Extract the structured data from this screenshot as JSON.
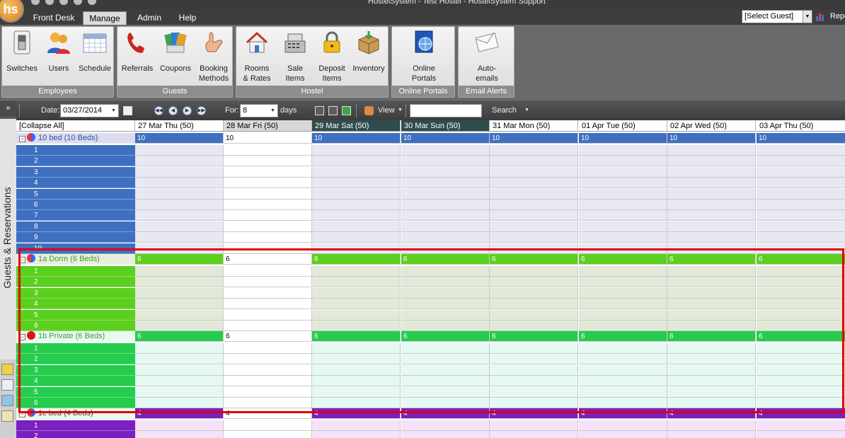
{
  "app": {
    "title": "HostelSystem - Test Hostel - HostelSystem Support",
    "logo_text": "hs"
  },
  "tabs": [
    {
      "label": "Front Desk"
    },
    {
      "label": "Manage"
    },
    {
      "label": "Admin"
    },
    {
      "label": "Help"
    }
  ],
  "guest_select": {
    "value": "[Select Guest]"
  },
  "report_label": "Repo",
  "ribbon": {
    "groups": [
      {
        "caption": "Employees",
        "buttons": [
          {
            "label": "Switches",
            "icon": "switch-icon"
          },
          {
            "label": "Users",
            "icon": "users-icon"
          },
          {
            "label": "Schedule",
            "icon": "calendar-icon"
          }
        ]
      },
      {
        "caption": "Guests",
        "buttons": [
          {
            "label": "Referrals",
            "icon": "phone-icon"
          },
          {
            "label": "Coupons",
            "icon": "coupons-icon"
          },
          {
            "label": "Booking\nMethods",
            "icon": "hand-icon"
          }
        ]
      },
      {
        "caption": "Hostel",
        "buttons": [
          {
            "label": "Rooms\n& Rates",
            "icon": "house-icon"
          },
          {
            "label": "Sale\nItems",
            "icon": "register-icon"
          },
          {
            "label": "Deposit\nItems",
            "icon": "lock-icon"
          },
          {
            "label": "Inventory",
            "icon": "box-icon"
          }
        ]
      },
      {
        "caption": "Online Portals",
        "buttons": [
          {
            "label": "Online\nPortals",
            "icon": "globe-icon"
          }
        ]
      },
      {
        "caption": "Email Alerts",
        "buttons": [
          {
            "label": "Auto-\nemails",
            "icon": "envelope-icon"
          }
        ]
      }
    ]
  },
  "side_panel": {
    "toggle": "»",
    "vertical_label": "Guests & Reservations"
  },
  "toolbar": {
    "date_label": "Date:",
    "date_value": "03/27/2014",
    "for_label": "For:",
    "for_value": "8",
    "days_label": "days",
    "view_label": "View",
    "search_value": "",
    "search_label": "Search"
  },
  "grid": {
    "collapse_label": "[Collapse All]",
    "columns": [
      "27 Mar Thu (50)",
      "28 Mar Fri (50)",
      "29 Mar Sat (50)",
      "30 Mar Sun (50)",
      "31 Mar Mon (50)",
      "01 Apr Tue (50)",
      "02 Apr Wed (50)",
      "03 Apr Thu (50)"
    ],
    "rooms": [
      {
        "name": "10 bed (10 Beds)",
        "count": "10",
        "beds": [
          "1",
          "2",
          "3",
          "4",
          "5",
          "6",
          "7",
          "8",
          "9",
          "10"
        ],
        "label_color": "#3f6fc0",
        "cell_color": "#e8e8f2",
        "header_color": "#3f6fc0"
      },
      {
        "name": "1a Dorm (6 Beds)",
        "count": "6",
        "beds": [
          "1",
          "2",
          "3",
          "4",
          "5",
          "6"
        ],
        "label_color": "#5bd01e",
        "cell_color": "#e3e9d8",
        "header_color": "#5bd01e"
      },
      {
        "name": "1b Private (6 Beds)",
        "count": "6",
        "beds": [
          "1",
          "2",
          "3",
          "4",
          "5",
          "6"
        ],
        "label_color": "#25cc4d",
        "cell_color": "#e6f8f2",
        "header_color": "#25cc4d"
      },
      {
        "name": "1c bed (4 Beds)",
        "count": "4",
        "beds": [
          "1",
          "2"
        ],
        "label_color": "#7a1fc0",
        "cell_color": "#f6e2f8",
        "header_color": "#7a1fc0"
      }
    ]
  }
}
